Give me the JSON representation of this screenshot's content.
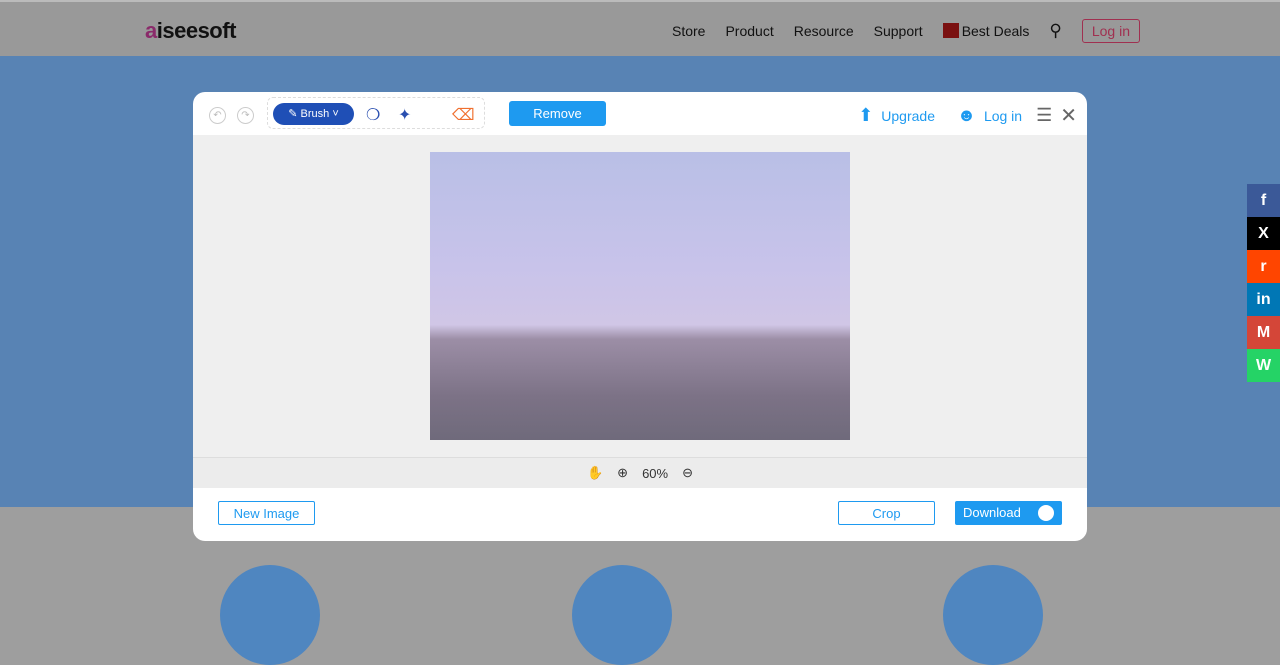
{
  "site": {
    "logo": "aiseesoft",
    "nav": [
      "Store",
      "Product",
      "Resource",
      "Support",
      "Best Deals"
    ],
    "login": "Log in"
  },
  "social": [
    "f",
    "X",
    "r",
    "in",
    "M",
    "W"
  ],
  "editor": {
    "brush_label": "Brush",
    "remove_label": "Remove",
    "upgrade_label": "Upgrade",
    "login_label": "Log in",
    "zoom_level": "60%",
    "new_image_label": "New Image",
    "crop_label": "Crop",
    "download_label": "Download"
  }
}
